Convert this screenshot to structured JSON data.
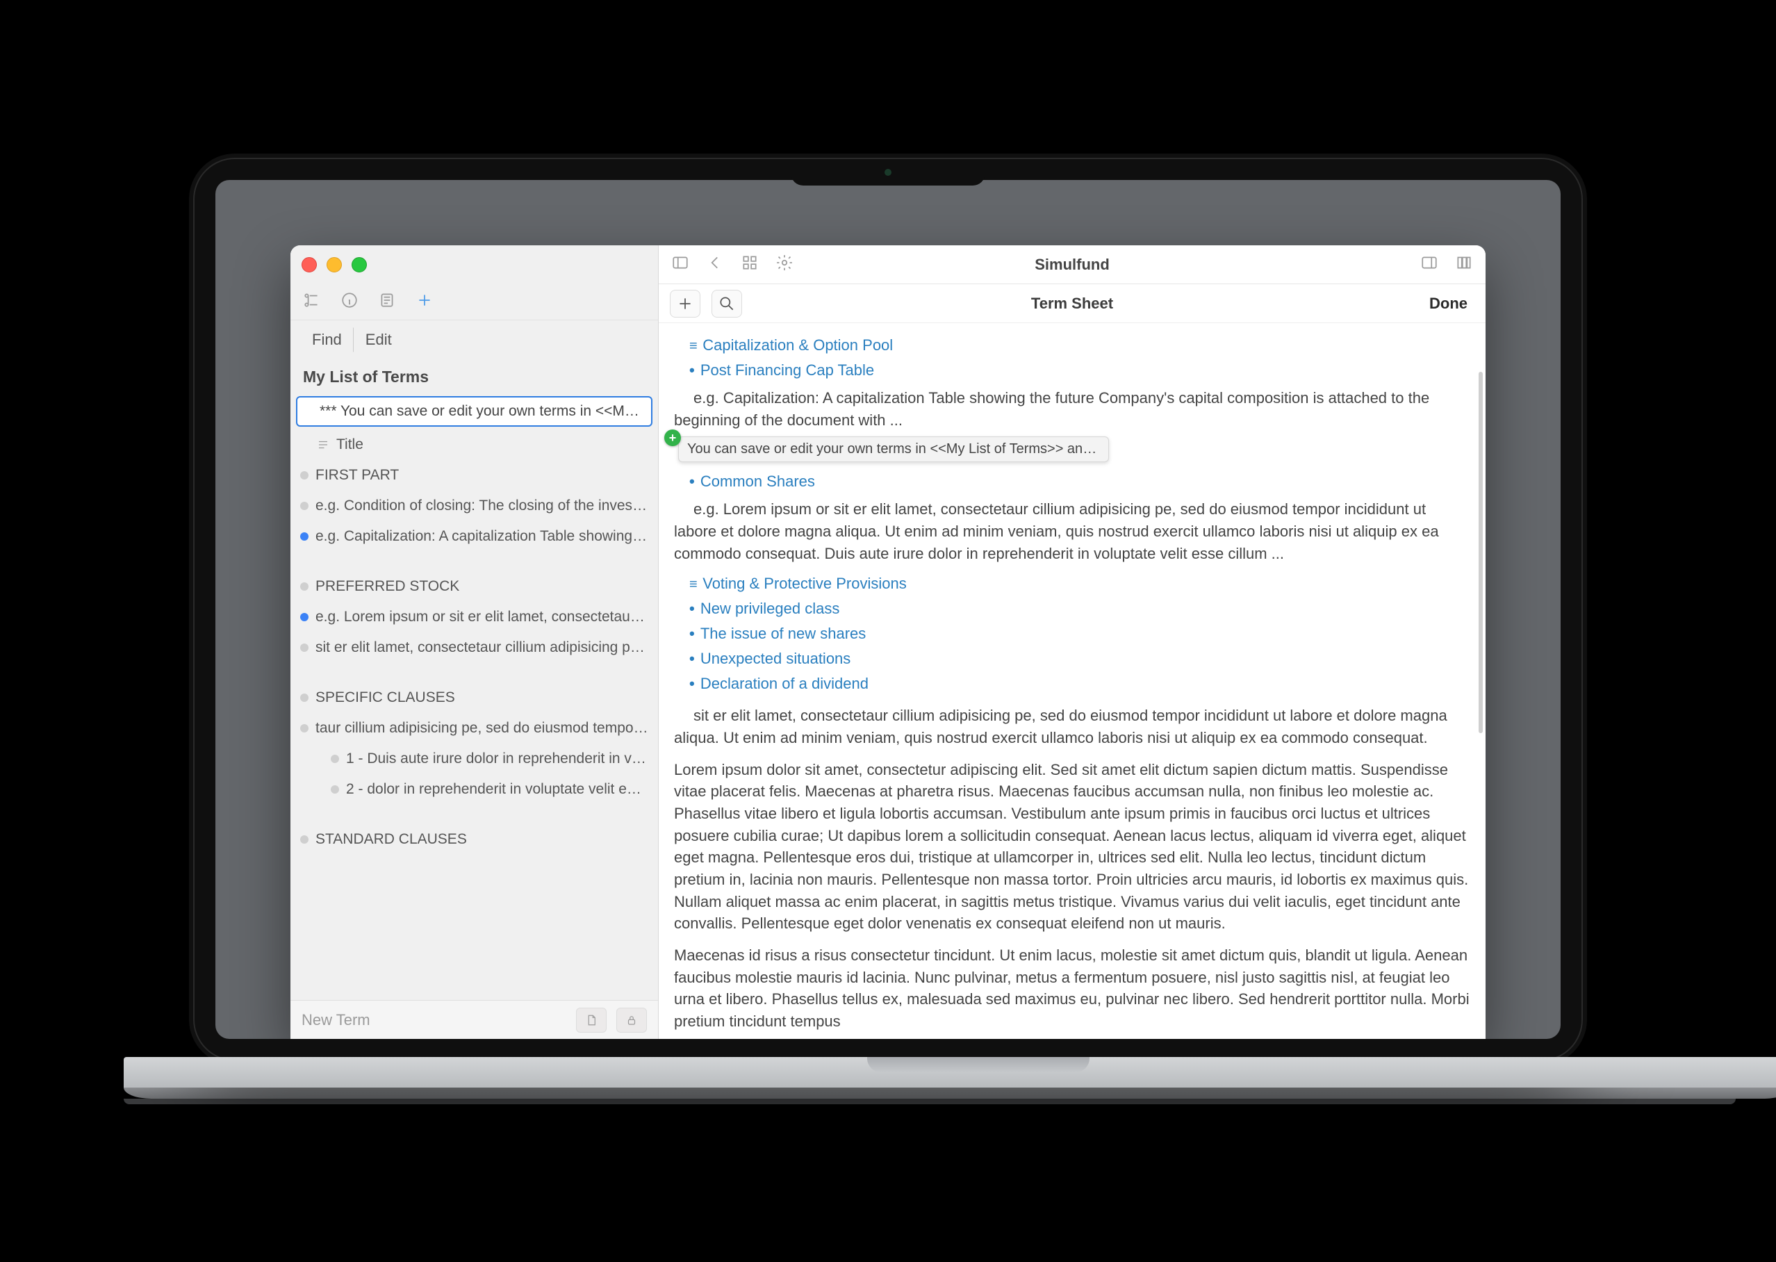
{
  "app": {
    "title": "Simulfund"
  },
  "sidebar": {
    "tabs": {
      "find": "Find",
      "edit": "Edit"
    },
    "heading": "My List of Terms",
    "footer_label": "New Term",
    "items": [
      {
        "text": "*** You can save or edit your own terms in <<My List...",
        "plain": true,
        "selected": true
      },
      {
        "text": "Title",
        "hicon": true,
        "indent": 1
      },
      {
        "text": "FIRST PART"
      },
      {
        "text": "e.g. Condition of closing: The closing of the investm..."
      },
      {
        "text": "e.g. Capitalization: A capitalization Table showing th...",
        "active": true
      },
      {
        "spacer": true
      },
      {
        "text": "PREFERRED STOCK"
      },
      {
        "text": "e.g. Lorem ipsum or sit er elit lamet, consectetaur cill...",
        "active": true
      },
      {
        "text": "sit er elit lamet, consectetaur cillium adipisicing pe, s..."
      },
      {
        "spacer": true
      },
      {
        "text": "SPECIFIC CLAUSES"
      },
      {
        "text": "taur cillium adipisicing pe, sed do eiusmod tempor in..."
      },
      {
        "text": "1 -   Duis aute irure dolor in reprehenderit in volupt...",
        "indent": 2
      },
      {
        "text": "2 -  dolor in reprehenderit in voluptate velit esse ali...",
        "indent": 2
      },
      {
        "spacer": true
      },
      {
        "text": "STANDARD CLAUSES"
      }
    ]
  },
  "editor": {
    "sub_title": "Term Sheet",
    "done": "Done",
    "drag_hint": "You can save or edit your own terms in <<My List of Terms>> and insert them i...",
    "content": {
      "section_cap": "Capitalization & Option Pool",
      "post_financing": "Post Financing Cap Table",
      "cap_body": "e.g. Capitalization: A capitalization Table showing the future Company's capital composition is attached to the beginning of the document with ...",
      "common_shares": "Common Shares",
      "lorem1": "e.g. Lorem ipsum or sit er elit lamet, consectetaur cillium adipisicing pe, sed do eiusmod tempor incididunt ut labore et dolore magna aliqua. Ut enim ad minim veniam, quis nostrud exercit ullamco laboris nisi ut aliquip ex ea commodo consequat. Duis aute irure dolor in reprehenderit in voluptate velit esse cillum ...",
      "voting": "Voting & Protective Provisions",
      "npc": "New privileged class",
      "new_shares": "The issue of new shares",
      "unexpected": "Unexpected situations",
      "dividend": "Declaration of a dividend",
      "sit_body": "sit er elit lamet, consectetaur cillium adipisicing pe, sed do eiusmod tempor incididunt ut labore et dolore magna aliqua. Ut enim ad minim veniam, quis nostrud exercit ullamco laboris nisi ut aliquip ex ea commodo consequat.",
      "para1": "Lorem ipsum dolor sit amet, consectetur adipiscing elit. Sed sit amet elit dictum sapien dictum mattis. Suspendisse vitae placerat felis. Maecenas at pharetra risus. Maecenas faucibus accumsan nulla, non finibus leo molestie ac. Phasellus vitae libero et ligula lobortis accumsan. Vestibulum ante ipsum primis in faucibus orci luctus et ultrices posuere cubilia curae; Ut dapibus lorem a sollicitudin consequat. Aenean lacus lectus, aliquam id viverra eget, aliquet eget magna. Pellentesque eros dui, tristique at ullamcorper in, ultrices sed elit. Nulla leo lectus, tincidunt dictum pretium in, lacinia non mauris. Pellentesque non massa tortor. Proin ultricies arcu mauris, id lobortis ex maximus quis. Nullam aliquet massa ac enim placerat, in sagittis metus tristique. Vivamus varius dui velit iaculis, eget tincidunt ante convallis. Pellentesque eget dolor venenatis ex consequat eleifend non ut mauris.",
      "para2": "Maecenas id risus a risus consectetur tincidunt. Ut enim lacus, molestie sit amet dictum quis, blandit ut ligula. Aenean faucibus molestie mauris id lacinia. Nunc pulvinar, metus a fermentum posuere, nisl justo sagittis nisl, at feugiat leo urna et libero. Phasellus tellus ex, malesuada sed maximus eu, pulvinar nec libero. Sed hendrerit porttitor nulla. Morbi pretium tincidunt tempus"
    }
  }
}
